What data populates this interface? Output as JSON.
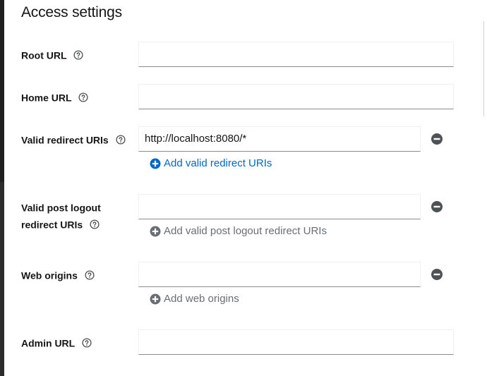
{
  "section_title": "Access settings",
  "fields": {
    "root_url": {
      "label": "Root URL",
      "value": ""
    },
    "home_url": {
      "label": "Home URL",
      "value": ""
    },
    "valid_redirect_uris": {
      "label": "Valid redirect URIs",
      "value": "http://localhost:8080/*",
      "add_label": "Add valid redirect URIs"
    },
    "valid_post_logout": {
      "label_line1": "Valid post logout",
      "label_line2": "redirect URIs",
      "value": "",
      "add_label": "Add valid post logout redirect URIs"
    },
    "web_origins": {
      "label": "Web origins",
      "value": "",
      "add_label": "Add web origins"
    },
    "admin_url": {
      "label": "Admin URL",
      "value": ""
    }
  },
  "icons": {
    "help": "question-circle-icon",
    "remove": "minus-circle-icon",
    "add": "plus-circle-icon"
  },
  "colors": {
    "link_active": "#0066cc",
    "link_disabled": "#6a6e73",
    "icon_dark": "#4f5255",
    "input_border": "#8a8d90"
  }
}
